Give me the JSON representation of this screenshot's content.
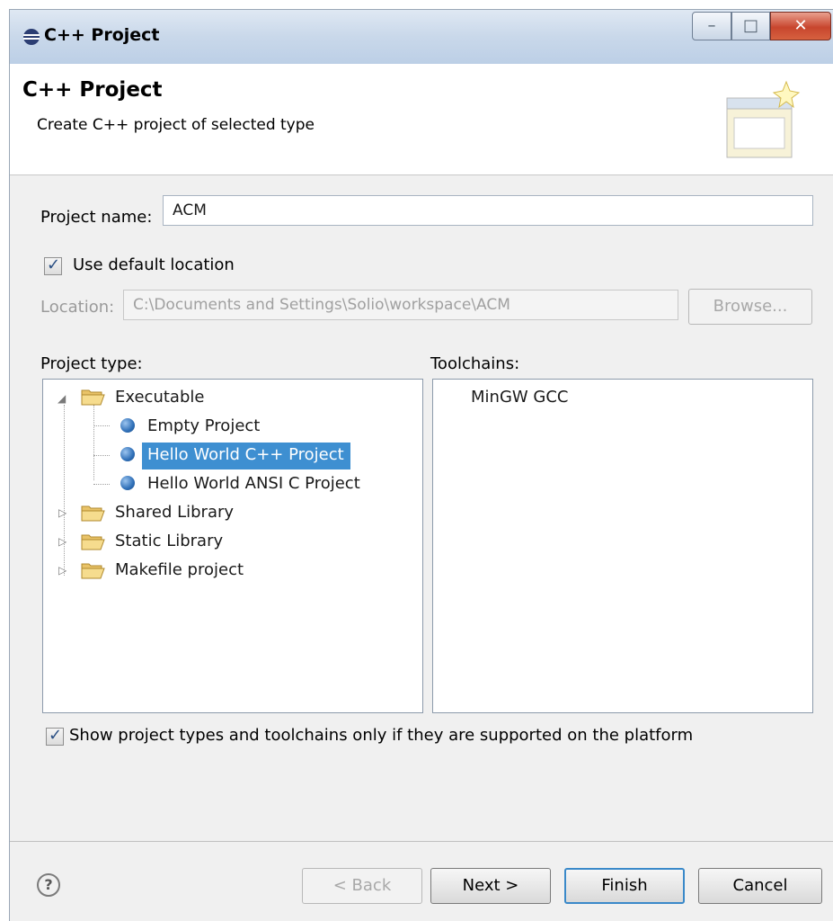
{
  "window": {
    "title": "C++ Project"
  },
  "banner": {
    "title": "C++ Project",
    "description": "Create C++ project of selected type"
  },
  "form": {
    "project_name_label": "Project name:",
    "project_name_value": "ACM",
    "use_default_location_label": "Use default location",
    "use_default_location_checked": true,
    "location_label": "Location:",
    "location_value": "C:\\Documents and Settings\\Solio\\workspace\\ACM",
    "browse_label": "Browse...",
    "project_type_label": "Project type:",
    "toolchains_label": "Toolchains:",
    "show_supported_label": "Show project types and toolchains only if they are supported on the platform",
    "show_supported_checked": true
  },
  "project_types": {
    "executable": "Executable",
    "items": [
      "Empty Project",
      "Hello World C++ Project",
      "Hello World ANSI C Project"
    ],
    "selected": "Hello World C++ Project",
    "shared_library": "Shared Library",
    "static_library": "Static Library",
    "makefile_project": "Makefile project"
  },
  "toolchains": {
    "items": [
      "MinGW GCC"
    ]
  },
  "footer": {
    "back_label": "< Back",
    "next_label": "Next >",
    "finish_label": "Finish",
    "cancel_label": "Cancel"
  },
  "colors": {
    "selection": "#3e8fd1",
    "title_bar": "#c9d8ea",
    "close_button": "#c8462e"
  }
}
